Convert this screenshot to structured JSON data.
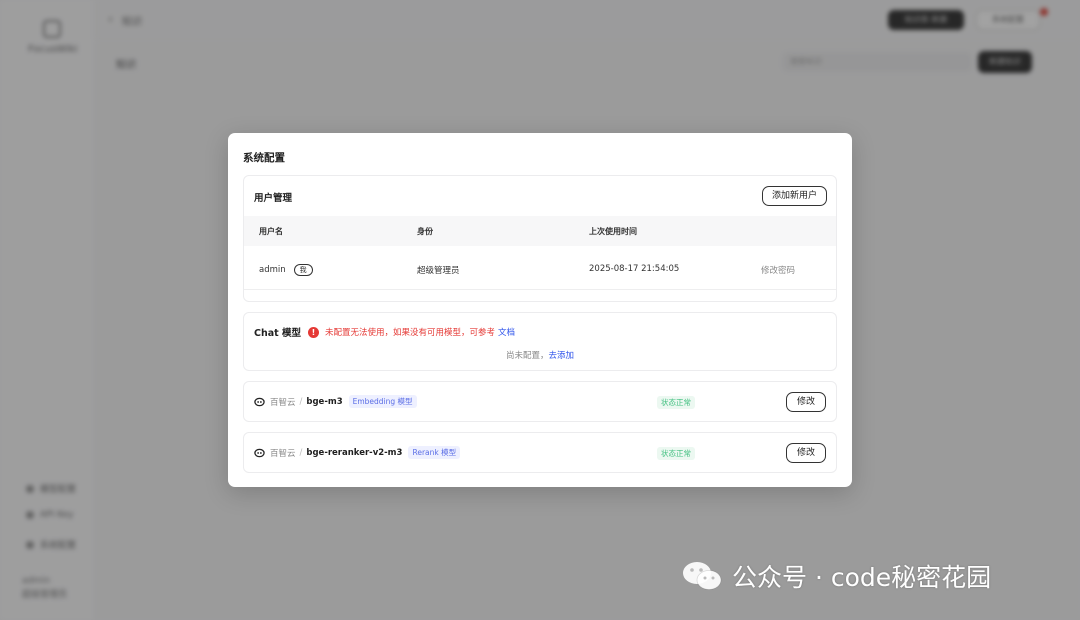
{
  "background": {
    "logo_text": "FocusWiki",
    "top_title": "知识",
    "top_dark_button": "知识库 新建",
    "top_light_button": "系统配置",
    "content_title": "知识",
    "search_placeholder": "搜索知识",
    "add_button": "新建知识",
    "sidebar_items": [
      "模型配置",
      "API Key",
      "系统配置"
    ],
    "user_name": "admin",
    "user_role": "超级管理员"
  },
  "modal": {
    "title": "系统配置",
    "user_management": {
      "title": "用户管理",
      "add_user_label": "添加新用户",
      "columns": [
        "用户名",
        "身份",
        "上次使用时间"
      ],
      "rows": [
        {
          "username": "admin",
          "me_badge": "我",
          "role": "超级管理员",
          "last_used": "2025-08-17 21:54:05",
          "action": "修改密码"
        }
      ]
    },
    "chat_model": {
      "label": "Chat 模型",
      "warning": "未配置无法使用，如果没有可用模型，可参考",
      "doc_link": "文档",
      "empty_text": "尚未配置，",
      "add_link": "去添加"
    },
    "models": [
      {
        "provider": "百智云",
        "separator": "/",
        "name": "bge-m3",
        "type_tag": "Embedding 模型",
        "status": "状态正常",
        "edit_label": "修改"
      },
      {
        "provider": "百智云",
        "separator": "/",
        "name": "bge-reranker-v2-m3",
        "type_tag": "Rerank 模型",
        "status": "状态正常",
        "edit_label": "修改"
      }
    ]
  },
  "watermark": "公众号 · code秘密花园",
  "colors": {
    "warning": "#e53935",
    "link": "#2f54eb",
    "status_ok": "#3fbf7f",
    "tag": "#5b6ee6"
  }
}
